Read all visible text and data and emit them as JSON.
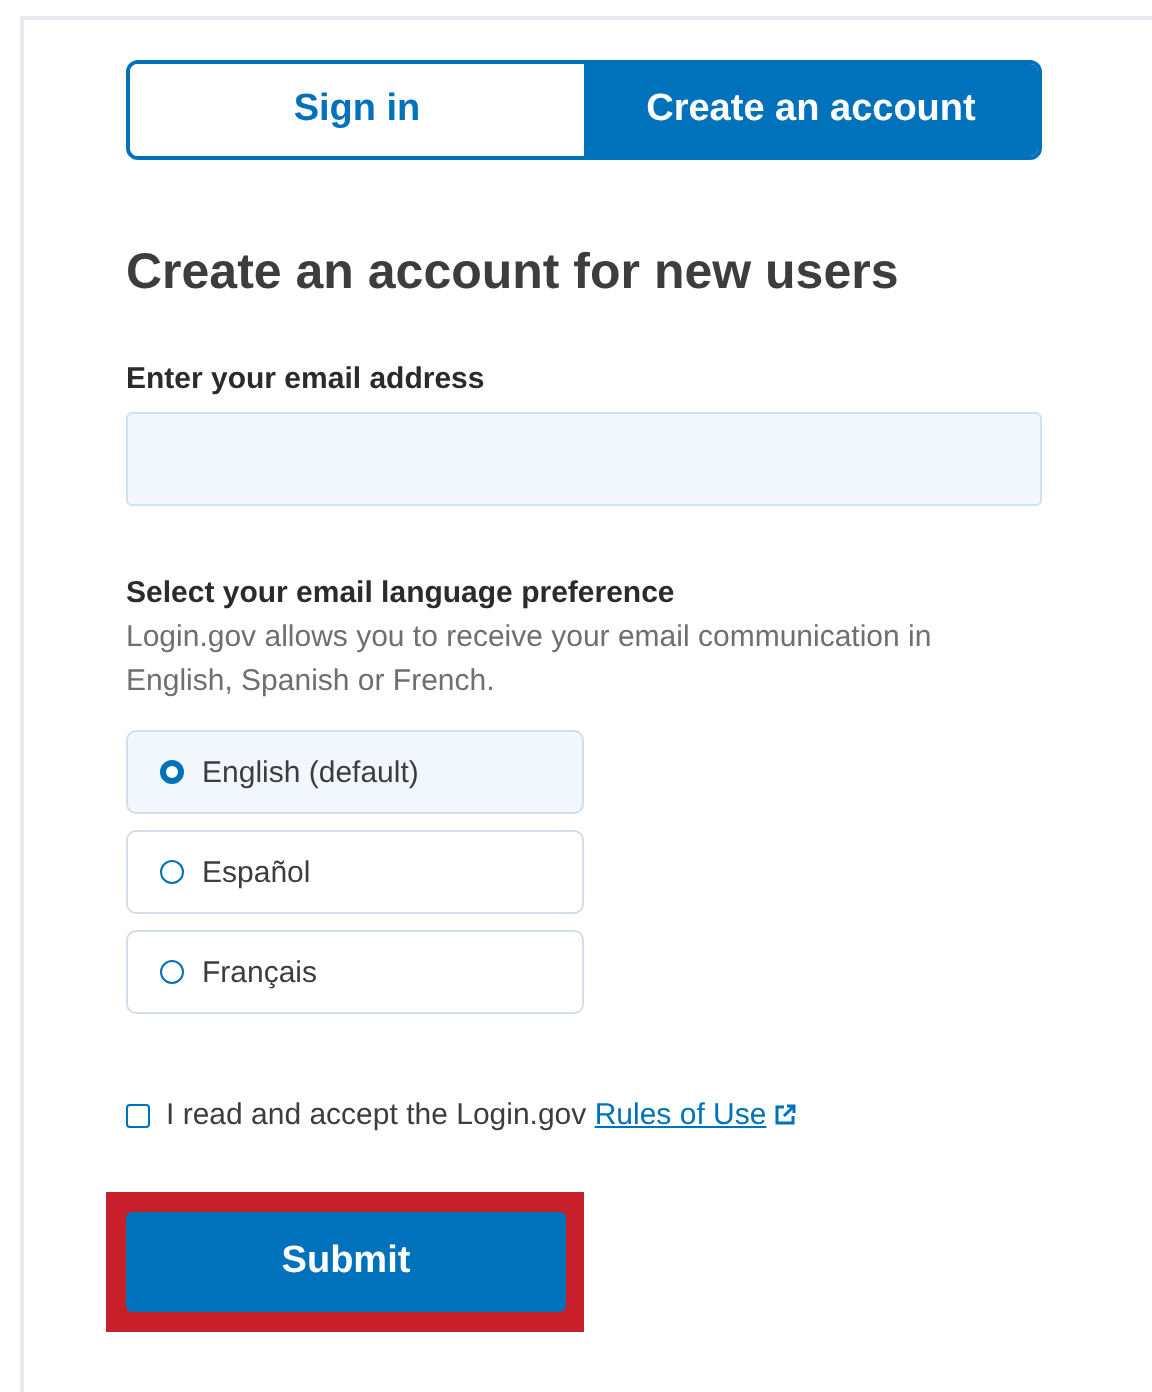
{
  "tabs": [
    {
      "label": "Sign in",
      "selected": false
    },
    {
      "label": "Create an account",
      "selected": true
    }
  ],
  "heading": "Create an account for new users",
  "email_field": {
    "label": "Enter your email address"
  },
  "language": {
    "legend": "Select your email language preference",
    "hint": "Login.gov allows you to receive your email communication in English, Spanish or French.",
    "options": [
      {
        "label": "English (default)",
        "selected": true
      },
      {
        "label": "Español",
        "selected": false
      },
      {
        "label": "Français",
        "selected": false
      }
    ]
  },
  "terms": {
    "text": "I read and accept the Login.gov",
    "link": "Rules of Use",
    "checked": false
  },
  "submit": {
    "label": "Submit",
    "highlighted": true
  }
}
